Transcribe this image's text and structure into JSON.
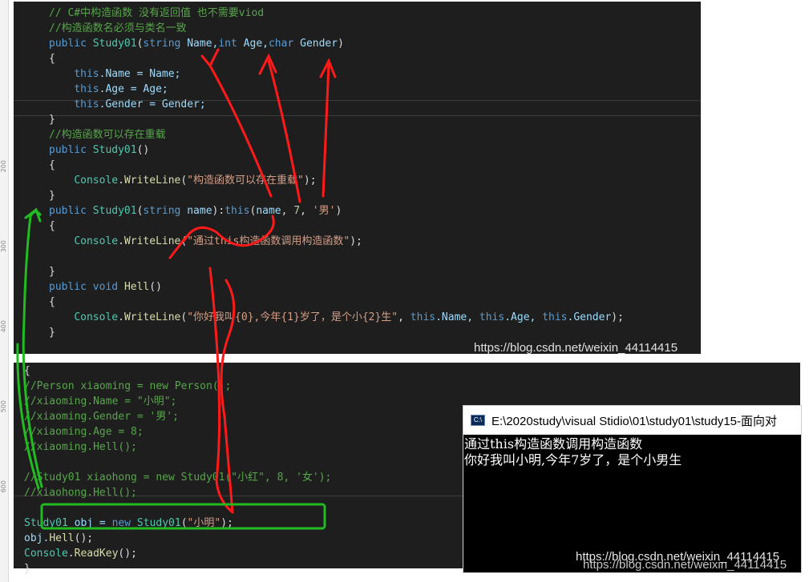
{
  "ruler_labels": [
    "200",
    "300",
    "400",
    "500",
    "600"
  ],
  "top_editor": {
    "lines": [
      [
        {
          "t": "// C#中构造函数 没有返回值 也不需要viod",
          "c": "cmt"
        }
      ],
      [
        {
          "t": "//构造函数名必须与类名一致",
          "c": "cmt"
        }
      ],
      [
        {
          "t": "public",
          "c": "kw"
        },
        {
          "t": " ",
          "c": "pl"
        },
        {
          "t": "Study01",
          "c": "ty"
        },
        {
          "t": "(",
          "c": "pl"
        },
        {
          "t": "string",
          "c": "kw"
        },
        {
          "t": " Name,",
          "c": "id"
        },
        {
          "t": "int",
          "c": "kw"
        },
        {
          "t": " Age,",
          "c": "id"
        },
        {
          "t": "char",
          "c": "kw"
        },
        {
          "t": " Gender",
          "c": "id"
        },
        {
          "t": ")",
          "c": "pl"
        }
      ],
      [
        {
          "t": "{",
          "c": "pl"
        }
      ],
      [
        {
          "t": "    ",
          "c": "pl"
        },
        {
          "t": "this",
          "c": "kw"
        },
        {
          "t": ".Name = Name;",
          "c": "id"
        }
      ],
      [
        {
          "t": "    ",
          "c": "pl"
        },
        {
          "t": "this",
          "c": "kw"
        },
        {
          "t": ".Age = Age;",
          "c": "id"
        }
      ],
      [
        {
          "t": "    ",
          "c": "pl"
        },
        {
          "t": "this",
          "c": "kw"
        },
        {
          "t": ".Gender = Gender;",
          "c": "id"
        }
      ],
      [
        {
          "t": "}",
          "c": "pl"
        }
      ],
      [
        {
          "t": "//构造函数可以存在重载",
          "c": "cmt"
        }
      ],
      [
        {
          "t": "public",
          "c": "kw"
        },
        {
          "t": " ",
          "c": "pl"
        },
        {
          "t": "Study01",
          "c": "ty"
        },
        {
          "t": "()",
          "c": "pl"
        }
      ],
      [
        {
          "t": "{",
          "c": "pl"
        }
      ],
      [
        {
          "t": "    ",
          "c": "pl"
        },
        {
          "t": "Console",
          "c": "ty"
        },
        {
          "t": ".",
          "c": "pl"
        },
        {
          "t": "WriteLine",
          "c": "fn"
        },
        {
          "t": "(",
          "c": "pl"
        },
        {
          "t": "\"构造函数可以存在重载\"",
          "c": "str"
        },
        {
          "t": ");",
          "c": "pl"
        }
      ],
      [
        {
          "t": "}",
          "c": "pl"
        }
      ],
      [
        {
          "t": "public",
          "c": "kw"
        },
        {
          "t": " ",
          "c": "pl"
        },
        {
          "t": "Study01",
          "c": "ty"
        },
        {
          "t": "(",
          "c": "pl"
        },
        {
          "t": "string",
          "c": "kw"
        },
        {
          "t": " name",
          "c": "id"
        },
        {
          "t": "):",
          "c": "pl"
        },
        {
          "t": "this",
          "c": "kw"
        },
        {
          "t": "(",
          "c": "pl"
        },
        {
          "t": "name",
          "c": "id"
        },
        {
          "t": ", ",
          "c": "pl"
        },
        {
          "t": "7",
          "c": "num"
        },
        {
          "t": ", ",
          "c": "pl"
        },
        {
          "t": "'男'",
          "c": "str"
        },
        {
          "t": ")",
          "c": "pl"
        }
      ],
      [
        {
          "t": "{",
          "c": "pl"
        }
      ],
      [
        {
          "t": "    ",
          "c": "pl"
        },
        {
          "t": "Console",
          "c": "ty"
        },
        {
          "t": ".",
          "c": "pl"
        },
        {
          "t": "WriteLine",
          "c": "fn"
        },
        {
          "t": "(",
          "c": "pl"
        },
        {
          "t": "\"通过this构造函数调用构造函数\"",
          "c": "str"
        },
        {
          "t": ");",
          "c": "pl"
        }
      ],
      [
        {
          "t": "",
          "c": "pl"
        }
      ],
      [
        {
          "t": "}",
          "c": "pl"
        }
      ],
      [
        {
          "t": "public",
          "c": "kw"
        },
        {
          "t": " ",
          "c": "pl"
        },
        {
          "t": "void",
          "c": "kw"
        },
        {
          "t": " ",
          "c": "pl"
        },
        {
          "t": "Hell",
          "c": "fn"
        },
        {
          "t": "()",
          "c": "pl"
        }
      ],
      [
        {
          "t": "{",
          "c": "pl"
        }
      ],
      [
        {
          "t": "    ",
          "c": "pl"
        },
        {
          "t": "Console",
          "c": "ty"
        },
        {
          "t": ".",
          "c": "pl"
        },
        {
          "t": "WriteLine",
          "c": "fn"
        },
        {
          "t": "(",
          "c": "pl"
        },
        {
          "t": "\"你好我叫{0},今年{1}岁了，是个小{2}生\"",
          "c": "str"
        },
        {
          "t": ", ",
          "c": "pl"
        },
        {
          "t": "this",
          "c": "kw"
        },
        {
          "t": ".Name, ",
          "c": "id"
        },
        {
          "t": "this",
          "c": "kw"
        },
        {
          "t": ".Age, ",
          "c": "id"
        },
        {
          "t": "this",
          "c": "kw"
        },
        {
          "t": ".Gender",
          "c": "id"
        },
        {
          "t": ");",
          "c": "pl"
        }
      ],
      [
        {
          "t": "}",
          "c": "pl"
        }
      ]
    ],
    "watermark": "https://blog.csdn.net/weixin_44114415"
  },
  "bottom_editor": {
    "lines": [
      [
        {
          "t": "{",
          "c": "pl"
        }
      ],
      [
        {
          "t": "//Person xiaoming = new Person();",
          "c": "cmt"
        }
      ],
      [
        {
          "t": "//xiaoming.Name = \"小明\";",
          "c": "cmt"
        }
      ],
      [
        {
          "t": "//xiaoming.Gender = '男';",
          "c": "cmt"
        }
      ],
      [
        {
          "t": "//xiaoming.Age = 8;",
          "c": "cmt"
        }
      ],
      [
        {
          "t": "//xiaoming.Hell();",
          "c": "cmt"
        }
      ],
      [
        {
          "t": "",
          "c": "pl"
        }
      ],
      [
        {
          "t": "//Study01 xiaohong = new Study01(\"小红\", 8, '女');",
          "c": "cmt"
        }
      ],
      [
        {
          "t": "//xiaohong.Hell();",
          "c": "cmt"
        }
      ],
      [
        {
          "t": "",
          "c": "pl"
        }
      ],
      [
        {
          "t": "Study01",
          "c": "ty"
        },
        {
          "t": " obj = ",
          "c": "id"
        },
        {
          "t": "new",
          "c": "kw"
        },
        {
          "t": " ",
          "c": "pl"
        },
        {
          "t": "Study01",
          "c": "ty"
        },
        {
          "t": "(",
          "c": "pl"
        },
        {
          "t": "\"小明\"",
          "c": "str"
        },
        {
          "t": ");",
          "c": "pl"
        }
      ],
      [
        {
          "t": "obj.",
          "c": "id"
        },
        {
          "t": "Hell",
          "c": "fn"
        },
        {
          "t": "();",
          "c": "pl"
        }
      ],
      [
        {
          "t": "Console",
          "c": "ty"
        },
        {
          "t": ".",
          "c": "pl"
        },
        {
          "t": "ReadKey",
          "c": "fn"
        },
        {
          "t": "();",
          "c": "pl"
        }
      ],
      [
        {
          "t": "}",
          "c": "pl"
        }
      ]
    ]
  },
  "console": {
    "title": "E:\\2020study\\visual Stidio\\01\\study01\\study15-面向对",
    "output": [
      "通过this构造函数调用构造函数",
      "你好我叫小明,今年7岁了，是个小男生"
    ],
    "watermark": "https://blog.csdn.net/weixin_44114415"
  },
  "bottom_watermark": "https://blog.csdn.net/weixin_44114415"
}
